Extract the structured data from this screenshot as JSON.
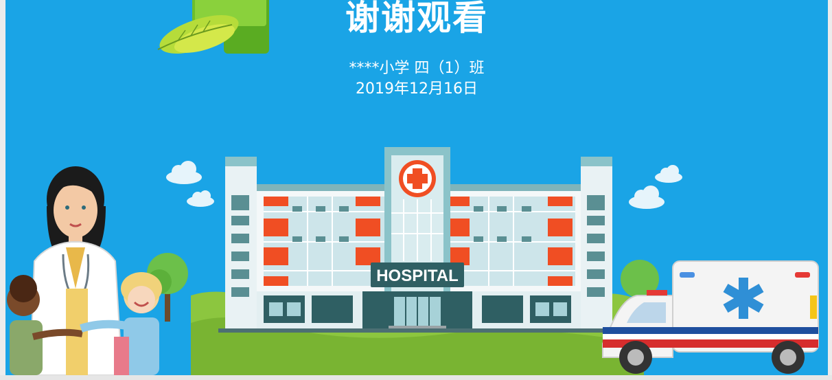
{
  "slide": {
    "title": "谢谢观看",
    "subtitle": "****小学   四（1）班",
    "date": "2019年12月16日",
    "hospital_sign": "HOSPITAL"
  },
  "colors": {
    "background": "#1aa4e6",
    "grass": "#8cc63f",
    "accent_red": "#f04e23",
    "building_teal": "#5a8f93"
  },
  "icons": [
    "leaf-cross-icon",
    "hospital-cross-icon",
    "ambulance-star-of-life-icon"
  ]
}
